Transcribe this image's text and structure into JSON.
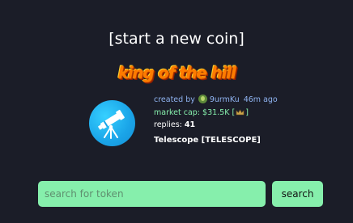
{
  "header": {
    "start_coin_label": "[start a new coin]"
  },
  "king_of_the_hill": {
    "label": "king of the hill",
    "coin": {
      "image_icon": "telescope-icon",
      "created_label": "created by",
      "creator": "9urmKu",
      "created_ago": "46m ago",
      "market_cap_label": "market cap: $31.5K",
      "market_cap_bracket_open": "[",
      "market_cap_bracket_close": "]",
      "market_cap_icon": "crown-icon",
      "replies_label": "replies:",
      "replies_count": "41",
      "name": "Telescope [TELESCOPE]"
    }
  },
  "search": {
    "placeholder": "search for token",
    "value": "",
    "button_label": "search"
  },
  "colors": {
    "background": "#1b1d28",
    "accent_green": "#86efac",
    "link_blue": "#8fb3f0",
    "koth_orange": "#ff7a00"
  }
}
